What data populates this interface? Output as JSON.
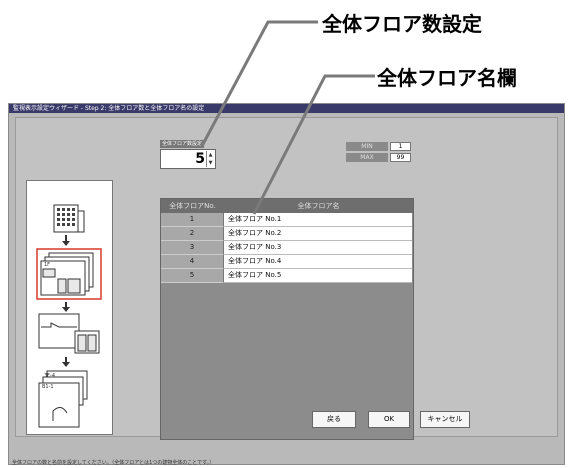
{
  "callouts": {
    "total_floor_count": "全体フロア数設定",
    "total_floor_name": "全体フロア名欄"
  },
  "window": {
    "title": "監視表示設定ウィザード - Step 2: 全体フロア数と全体フロア名の設定"
  },
  "form": {
    "count_label": "全体フロア数設定",
    "count_value": "5",
    "min_label": "MIN",
    "min_value": "1",
    "max_label": "MAX",
    "max_value": "99"
  },
  "table": {
    "columns": [
      "全体フロアNo.",
      "全体フロア名"
    ],
    "rows": [
      {
        "no": "1",
        "name": "全体フロア No.1"
      },
      {
        "no": "2",
        "name": "全体フロア No.2"
      },
      {
        "no": "3",
        "name": "全体フロア No.3"
      },
      {
        "no": "4",
        "name": "全体フロア No.4"
      },
      {
        "no": "5",
        "name": "全体フロア No.5"
      }
    ]
  },
  "buttons": {
    "back": "戻る",
    "ok": "OK",
    "cancel": "キャンセル"
  },
  "statusbar": "全体フロアの数と名前を設定してください。（全体フロアとは1つの建物全体のことです。）",
  "sidebar": {
    "floor_1f": "1F",
    "floor_range": "3F-4",
    "floor_b1": "B1-1"
  },
  "colors": {
    "accent_highlight": "#d83a2a",
    "window_bg": "#b9b9b9",
    "grid_bg": "#8c8c8c"
  }
}
